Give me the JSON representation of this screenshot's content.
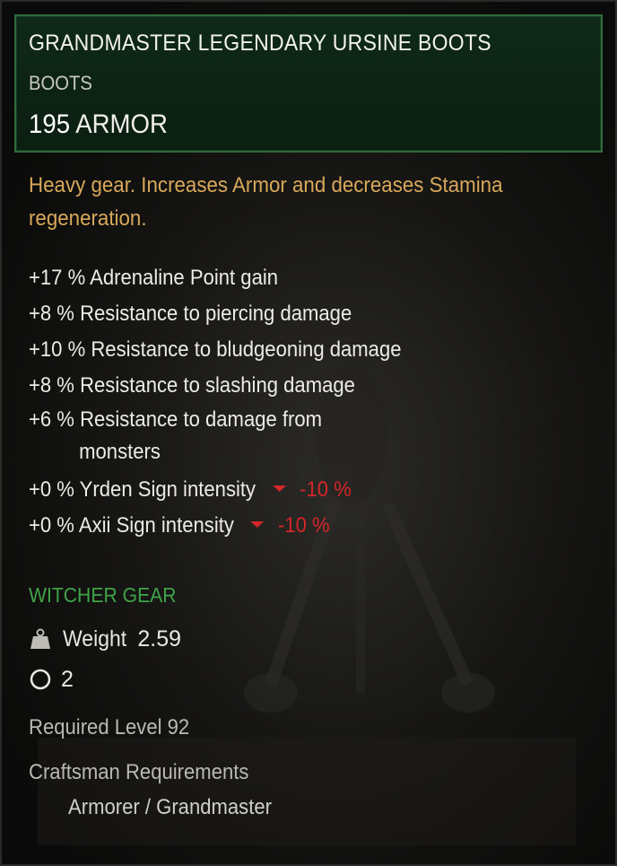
{
  "item": {
    "name": "GRANDMASTER LEGENDARY URSINE BOOTS",
    "type": "BOOTS",
    "armor_value": "195",
    "armor_label": "ARMOR",
    "description": "Heavy gear. Increases Armor and decreases Stamina regeneration."
  },
  "stats": [
    {
      "value": "+17 %",
      "label": "Adrenaline Point gain"
    },
    {
      "value": "+8 %",
      "label": "Resistance to piercing damage"
    },
    {
      "value": "+10 %",
      "label": "Resistance to bludgeoning damage"
    },
    {
      "value": "+8 %",
      "label": "Resistance to slashing damage"
    },
    {
      "value": "+6 %",
      "label_line1": "Resistance to damage from",
      "label_line2": "monsters"
    },
    {
      "value": "+0 %",
      "label": "Yrden Sign intensity",
      "delta": "-10 %"
    },
    {
      "value": "+0 %",
      "label": "Axii Sign intensity",
      "delta": "-10 %"
    }
  ],
  "gear_category": "WITCHER GEAR",
  "weight": {
    "label": "Weight",
    "value": "2.59",
    "icon": "weight-icon"
  },
  "slots": {
    "value": "2",
    "icon": "rune-slot-icon"
  },
  "required_level": "Required Level 92",
  "craftsman": {
    "label": "Craftsman Requirements",
    "value": "Armorer / Grandmaster"
  },
  "colors": {
    "header_border": "#2f6a3c",
    "header_bg": "#0f2a18",
    "description": "#d8a85a",
    "gear_category": "#3fa447",
    "negative": "#d6262a"
  }
}
